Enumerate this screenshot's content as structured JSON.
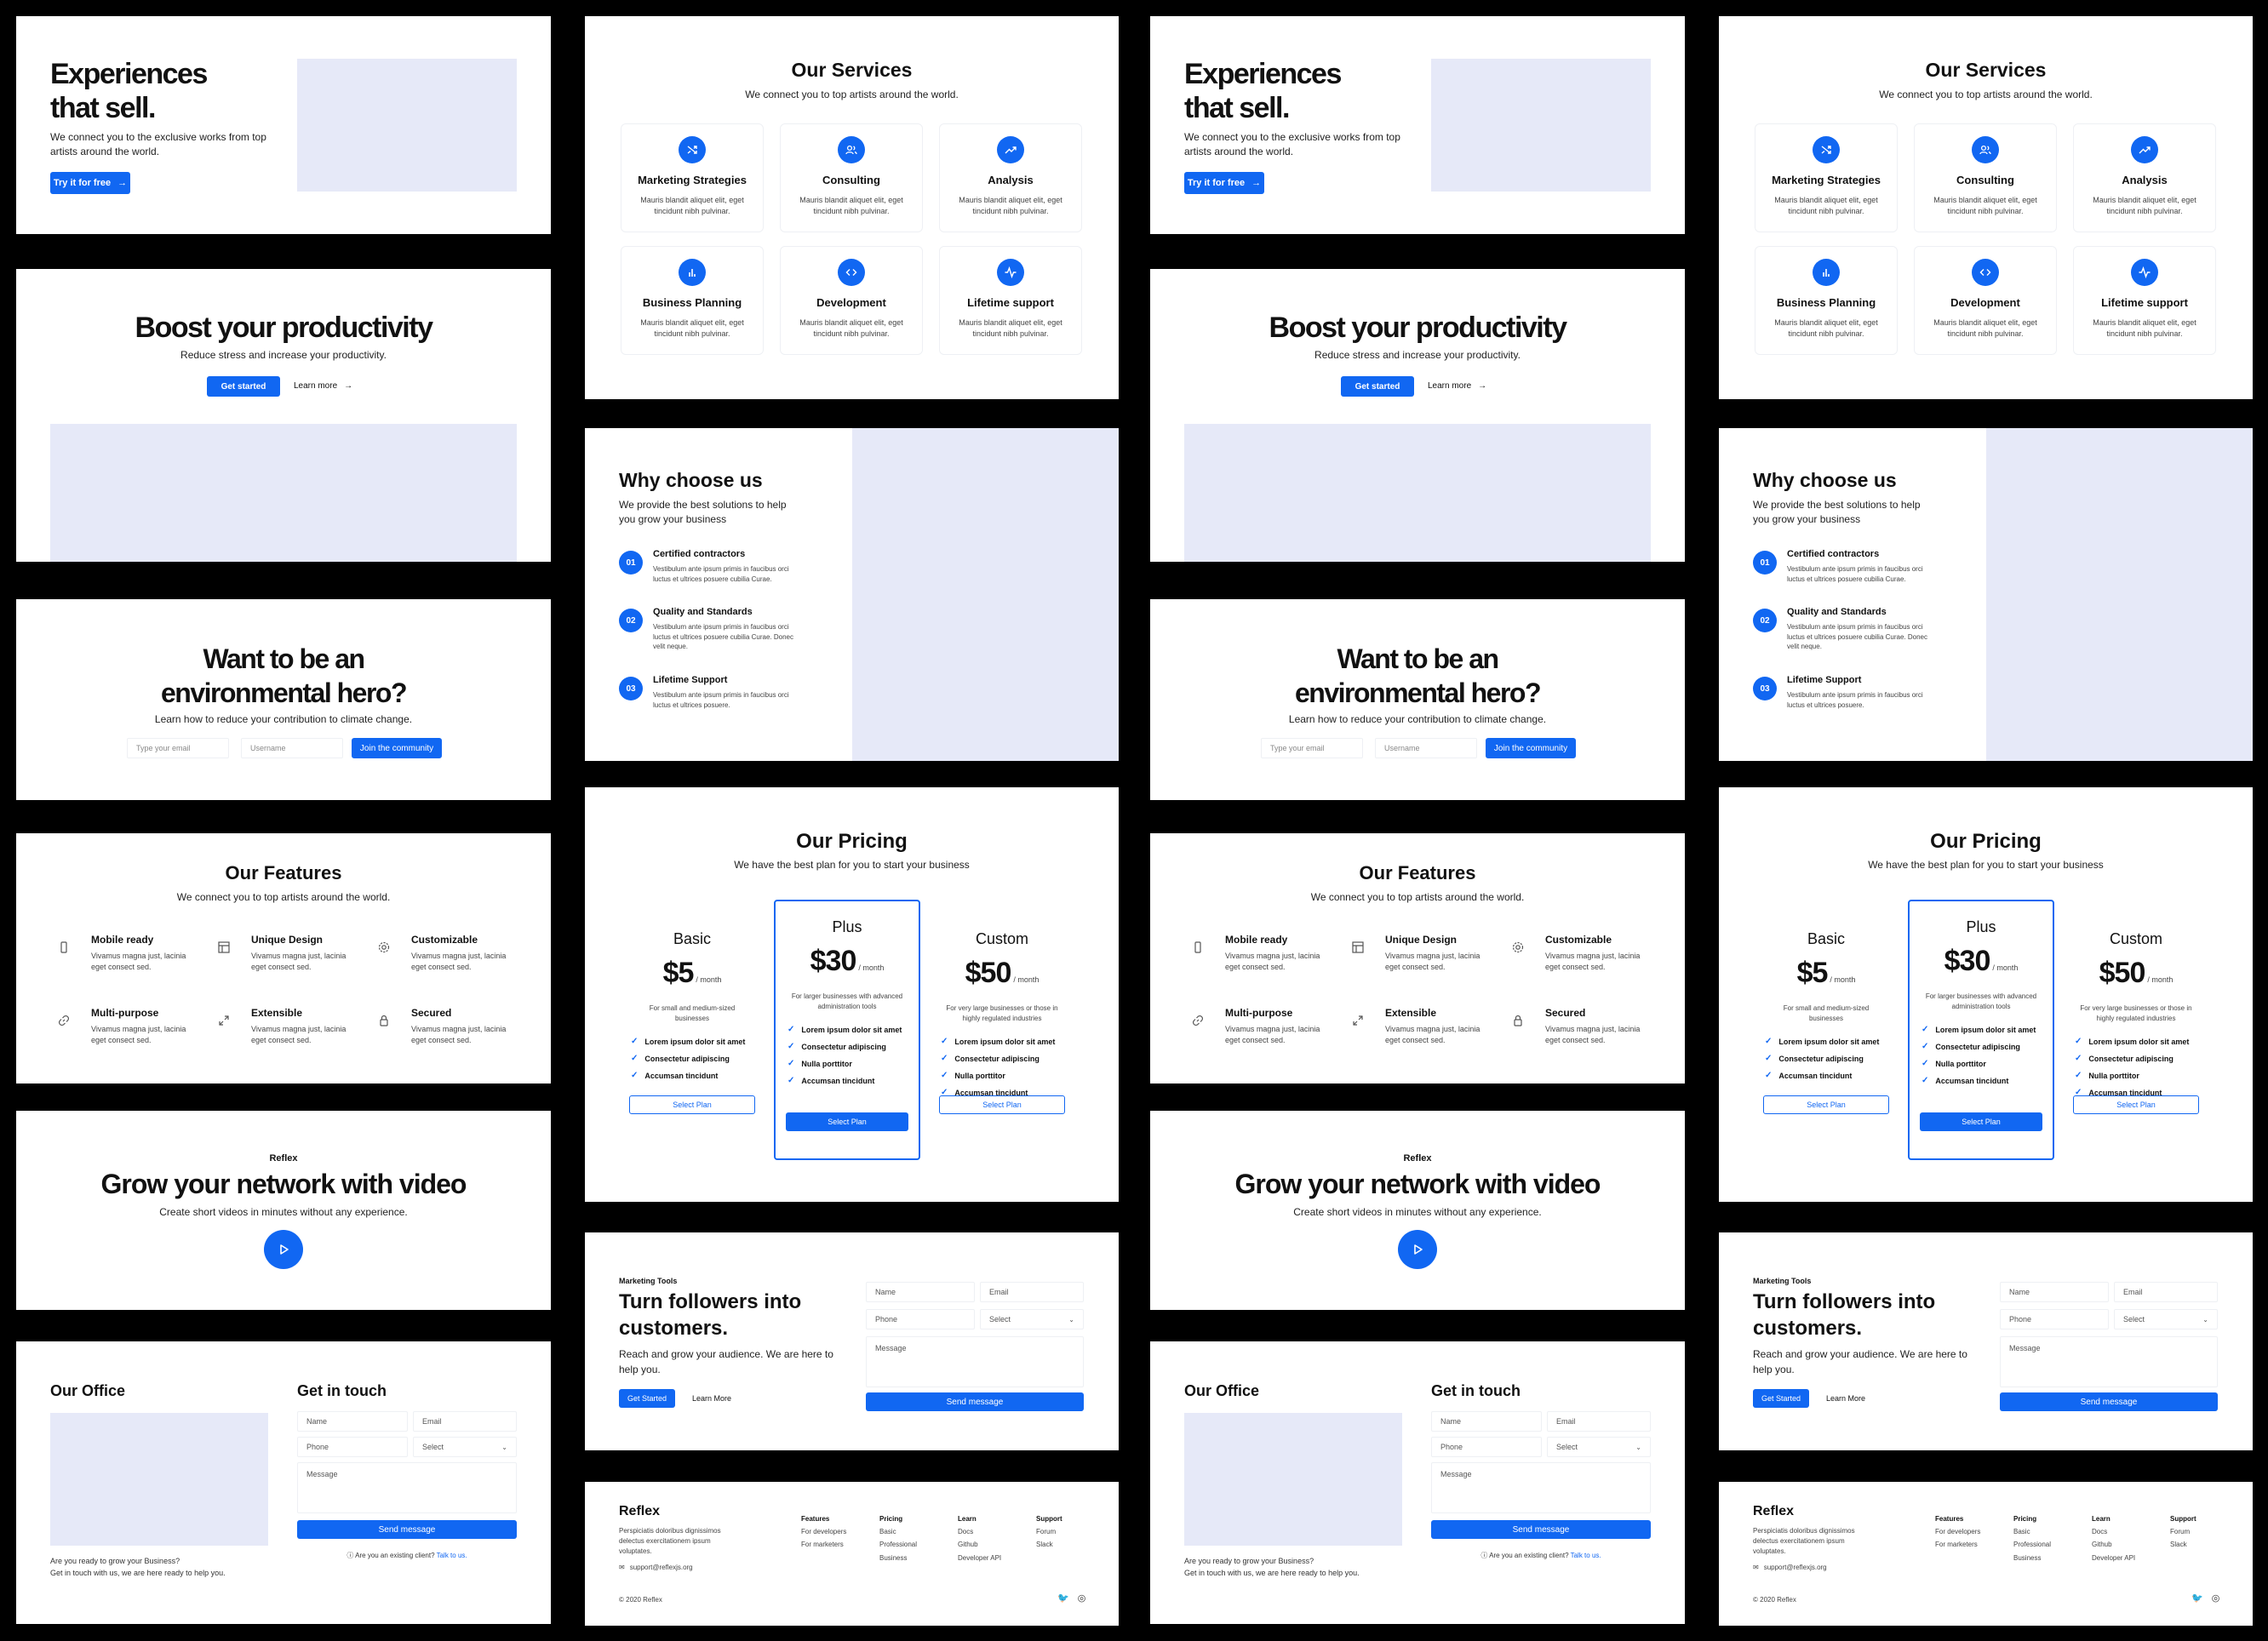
{
  "colors": {
    "accent": "#1167f2",
    "placeholder": "#e6e9f8",
    "background": "#000000"
  },
  "hero1": {
    "title_line1": "Experiences",
    "title_line2": "that sell.",
    "text": "We connect you to the exclusive works from top artists around the world.",
    "button": "Try it for free",
    "button_icon": "arrow-right-icon"
  },
  "productivity": {
    "title": "Boost your productivity",
    "subtitle": "Reduce stress and increase your productivity.",
    "primary_button": "Get started",
    "secondary_link": "Learn more"
  },
  "environment": {
    "title_line1": "Want to be an",
    "title_line2": "environmental hero?",
    "subtitle": "Learn how to reduce your contribution to climate change.",
    "email_placeholder": "Type your email",
    "username_placeholder": "Username",
    "button": "Join the community"
  },
  "features": {
    "title": "Our Features",
    "subtitle": "We connect you to top artists around the world.",
    "items": [
      {
        "title": "Mobile ready",
        "text": "Vivamus magna just, lacinia eget consect sed.",
        "icon": "mobile-icon"
      },
      {
        "title": "Unique Design",
        "text": "Vivamus magna just, lacinia eget consect sed.",
        "icon": "layout-icon"
      },
      {
        "title": "Customizable",
        "text": "Vivamus magna just, lacinia eget consect sed.",
        "icon": "gear-icon"
      },
      {
        "title": "Multi-purpose",
        "text": "Vivamus magna just, lacinia eget consect sed.",
        "icon": "link-icon"
      },
      {
        "title": "Extensible",
        "text": "Vivamus magna just, lacinia eget consect sed.",
        "icon": "expand-icon"
      },
      {
        "title": "Secured",
        "text": "Vivamus magna just, lacinia eget consect sed.",
        "icon": "lock-icon"
      }
    ]
  },
  "video": {
    "eyebrow": "Reflex",
    "title": "Grow your network with video",
    "subtitle": "Create short videos in minutes without any experience.",
    "play_icon": "play-icon"
  },
  "office": {
    "title": "Our Office",
    "text_line1": "Are you ready to grow your Business?",
    "text_line2": "Get in touch with us, we are here ready to help you.",
    "contact_title": "Get in touch",
    "name_placeholder": "Name",
    "email_placeholder": "Email",
    "phone_placeholder": "Phone",
    "select_value": "Select",
    "message_placeholder": "Message",
    "send_button": "Send message",
    "existing_client": "Are you an existing client?",
    "talk_link": "Talk to us."
  },
  "services": {
    "title": "Our Services",
    "subtitle": "We connect you to top artists around the world.",
    "items": [
      {
        "title": "Marketing Strategies",
        "text": "Mauris blandit aliquet elit, eget tincidunt nibh pulvinar.",
        "icon": "shuffle-icon"
      },
      {
        "title": "Consulting",
        "text": "Mauris blandit aliquet elit, eget tincidunt nibh pulvinar.",
        "icon": "users-icon"
      },
      {
        "title": "Analysis",
        "text": "Mauris blandit aliquet elit, eget tincidunt nibh pulvinar.",
        "icon": "trending-up-icon"
      },
      {
        "title": "Business Planning",
        "text": "Mauris blandit aliquet elit, eget tincidunt nibh pulvinar.",
        "icon": "bar-chart-icon"
      },
      {
        "title": "Development",
        "text": "Mauris blandit aliquet elit, eget tincidunt nibh pulvinar.",
        "icon": "code-icon"
      },
      {
        "title": "Lifetime support",
        "text": "Mauris blandit aliquet elit, eget tincidunt nibh pulvinar.",
        "icon": "activity-icon"
      }
    ]
  },
  "why": {
    "title": "Why choose us",
    "subtitle": "We provide the best solutions to help you grow your business",
    "items": [
      {
        "num": "01",
        "title": "Certified contractors",
        "text": "Vestibulum ante ipsum primis in faucibus orci luctus et ultrices posuere cubilia Curae."
      },
      {
        "num": "02",
        "title": "Quality and Standards",
        "text": "Vestibulum ante ipsum primis in faucibus orci luctus et ultrices posuere cubilia Curae. Donec velit neque."
      },
      {
        "num": "03",
        "title": "Lifetime Support",
        "text": "Vestibulum ante ipsum primis in faucibus orci luctus et ultrices posuere."
      }
    ]
  },
  "pricing": {
    "title": "Our Pricing",
    "subtitle": "We have the best plan for you to start your business",
    "per": "/ month",
    "plans": [
      {
        "name": "Basic",
        "price": "$5",
        "desc": "For small and medium-sized businesses",
        "features": [
          "Lorem ipsum dolor sit amet",
          "Consectetur adipiscing",
          "Accumsan tincidunt"
        ],
        "button": "Select Plan",
        "highlighted": false
      },
      {
        "name": "Plus",
        "price": "$30",
        "desc": "For larger businesses with advanced administration tools",
        "features": [
          "Lorem ipsum dolor sit amet",
          "Consectetur adipiscing",
          "Nulla porttitor",
          "Accumsan tincidunt"
        ],
        "button": "Select Plan",
        "highlighted": true
      },
      {
        "name": "Custom",
        "price": "$50",
        "desc": "For very large businesses or those in highly regulated industries",
        "features": [
          "Lorem ipsum dolor sit amet",
          "Consectetur adipiscing",
          "Nulla porttitor",
          "Accumsan tincidunt"
        ],
        "button": "Select Plan",
        "highlighted": false
      }
    ]
  },
  "marketing": {
    "eyebrow": "Marketing Tools",
    "title_line1": "Turn followers into",
    "title_line2": "customers.",
    "text": "Reach and grow your audience. We are here to help you.",
    "primary_button": "Get Started",
    "secondary_link": "Learn More",
    "name_placeholder": "Name",
    "email_placeholder": "Email",
    "phone_placeholder": "Phone",
    "select_value": "Select",
    "message_placeholder": "Message",
    "send_button": "Send message"
  },
  "footer": {
    "brand": "Reflex",
    "text": "Perspiciatis doloribus dignissimos delectus exercitationem ipsum voluptates.",
    "email": "support@reflexjs.org",
    "copyright": "© 2020 Reflex",
    "columns": [
      {
        "heading": "Features",
        "links": [
          "For developers",
          "For marketers"
        ]
      },
      {
        "heading": "Pricing",
        "links": [
          "Basic",
          "Professional",
          "Business"
        ]
      },
      {
        "heading": "Learn",
        "links": [
          "Docs",
          "Github",
          "Developer API"
        ]
      },
      {
        "heading": "Support",
        "links": [
          "Forum",
          "Slack"
        ]
      }
    ],
    "social_icons": [
      "twitter-icon",
      "instagram-icon"
    ]
  }
}
